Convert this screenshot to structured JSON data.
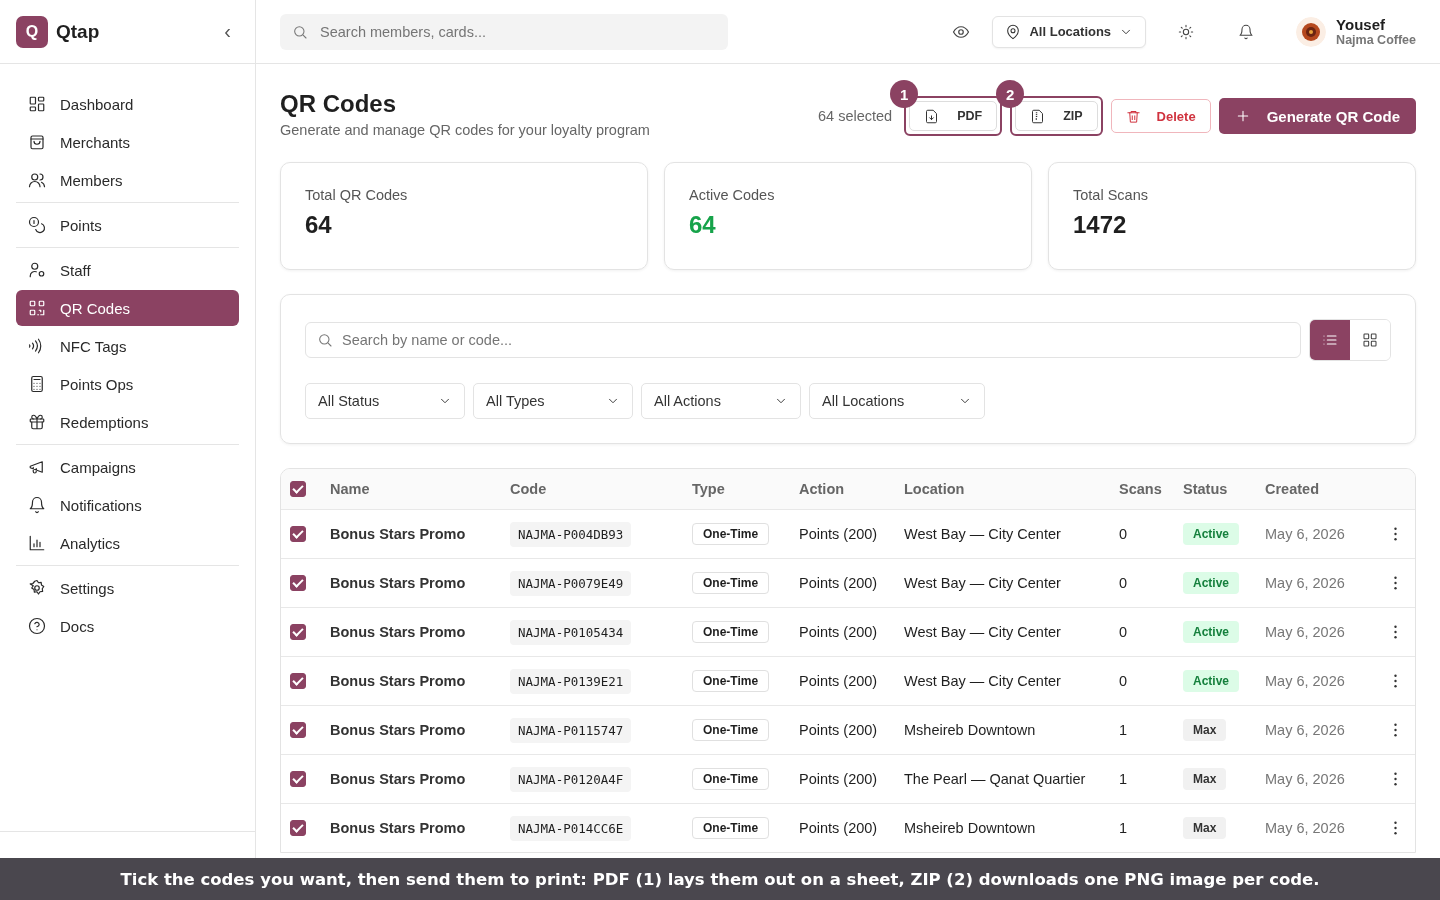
{
  "brand": {
    "logo_letter": "Q",
    "name": "Qtap",
    "collapse": "‹"
  },
  "sidebar": {
    "groups": [
      [
        {
          "label": "Dashboard",
          "selected": false
        },
        {
          "label": "Merchants",
          "selected": false
        },
        {
          "label": "Members",
          "selected": false
        }
      ],
      [
        {
          "label": "Points",
          "selected": false
        }
      ],
      [
        {
          "label": "Staff",
          "selected": false
        },
        {
          "label": "QR Codes",
          "selected": true
        },
        {
          "label": "NFC Tags",
          "selected": false
        },
        {
          "label": "Points Ops",
          "selected": false
        },
        {
          "label": "Redemptions",
          "selected": false
        }
      ],
      [
        {
          "label": "Campaigns",
          "selected": false
        },
        {
          "label": "Notifications",
          "selected": false
        },
        {
          "label": "Analytics",
          "selected": false
        }
      ],
      [
        {
          "label": "Settings",
          "selected": false
        },
        {
          "label": "Docs",
          "selected": false
        }
      ]
    ]
  },
  "header": {
    "search": {
      "placeholder": "Search members, cards..."
    },
    "location": "All Locations",
    "user": {
      "name": "Yousef",
      "org": "Najma Coffee"
    }
  },
  "page": {
    "title": "QR Codes",
    "subtitle": "Generate and manage QR codes for your loyalty program",
    "selected_count": "64 selected",
    "export_buttons": [
      {
        "label": "PDF",
        "callout": "1"
      },
      {
        "label": "ZIP",
        "callout": "2"
      }
    ],
    "delete_button": "Delete",
    "generate_button": "Generate QR Code"
  },
  "stats": [
    {
      "label": "Total QR Codes",
      "value": "64",
      "color": "#1f1f1f"
    },
    {
      "label": "Active Codes",
      "value": "64",
      "color": "#16a34a"
    },
    {
      "label": "Total Scans",
      "value": "1472",
      "color": "#1f1f1f"
    }
  ],
  "filters": {
    "search": {
      "placeholder": "Search by name or code..."
    },
    "views": [
      {
        "kind": "list",
        "selected": true
      },
      {
        "kind": "grid",
        "selected": false
      }
    ],
    "dropdowns": [
      "All Status",
      "All Types",
      "All Actions",
      "All Locations"
    ]
  },
  "table": {
    "all_checked": true,
    "columns": [
      "Name",
      "Code",
      "Type",
      "Action",
      "Location",
      "Scans",
      "Status",
      "Created"
    ],
    "rows": [
      {
        "checked": true,
        "name": "Bonus Stars Promo",
        "code": "NAJMA-P004DB93",
        "type": "One-Time",
        "action": "Points (200)",
        "location": "West Bay — City Center",
        "scans": "0",
        "status": {
          "label": "Active",
          "kind": "active"
        },
        "created": "May 6, 2026"
      },
      {
        "checked": true,
        "name": "Bonus Stars Promo",
        "code": "NAJMA-P0079E49",
        "type": "One-Time",
        "action": "Points (200)",
        "location": "West Bay — City Center",
        "scans": "0",
        "status": {
          "label": "Active",
          "kind": "active"
        },
        "created": "May 6, 2026"
      },
      {
        "checked": true,
        "name": "Bonus Stars Promo",
        "code": "NAJMA-P0105434",
        "type": "One-Time",
        "action": "Points (200)",
        "location": "West Bay — City Center",
        "scans": "0",
        "status": {
          "label": "Active",
          "kind": "active"
        },
        "created": "May 6, 2026"
      },
      {
        "checked": true,
        "name": "Bonus Stars Promo",
        "code": "NAJMA-P0139E21",
        "type": "One-Time",
        "action": "Points (200)",
        "location": "West Bay — City Center",
        "scans": "0",
        "status": {
          "label": "Active",
          "kind": "active"
        },
        "created": "May 6, 2026"
      },
      {
        "checked": true,
        "name": "Bonus Stars Promo",
        "code": "NAJMA-P0115747",
        "type": "One-Time",
        "action": "Points (200)",
        "location": "Msheireb Downtown",
        "scans": "1",
        "status": {
          "label": "Max",
          "kind": "max"
        },
        "created": "May 6, 2026"
      },
      {
        "checked": true,
        "name": "Bonus Stars Promo",
        "code": "NAJMA-P0120A4F",
        "type": "One-Time",
        "action": "Points (200)",
        "location": "The Pearl — Qanat Quartier",
        "scans": "1",
        "status": {
          "label": "Max",
          "kind": "max"
        },
        "created": "May 6, 2026"
      },
      {
        "checked": true,
        "name": "Bonus Stars Promo",
        "code": "NAJMA-P014CC6E",
        "type": "One-Time",
        "action": "Points (200)",
        "location": "Msheireb Downtown",
        "scans": "1",
        "status": {
          "label": "Max",
          "kind": "max"
        },
        "created": "May 6, 2026"
      }
    ]
  },
  "caption": "Tick the codes you want, then send them to print: PDF (1) lays them out on a sheet, ZIP (2) downloads one PNG image per code."
}
